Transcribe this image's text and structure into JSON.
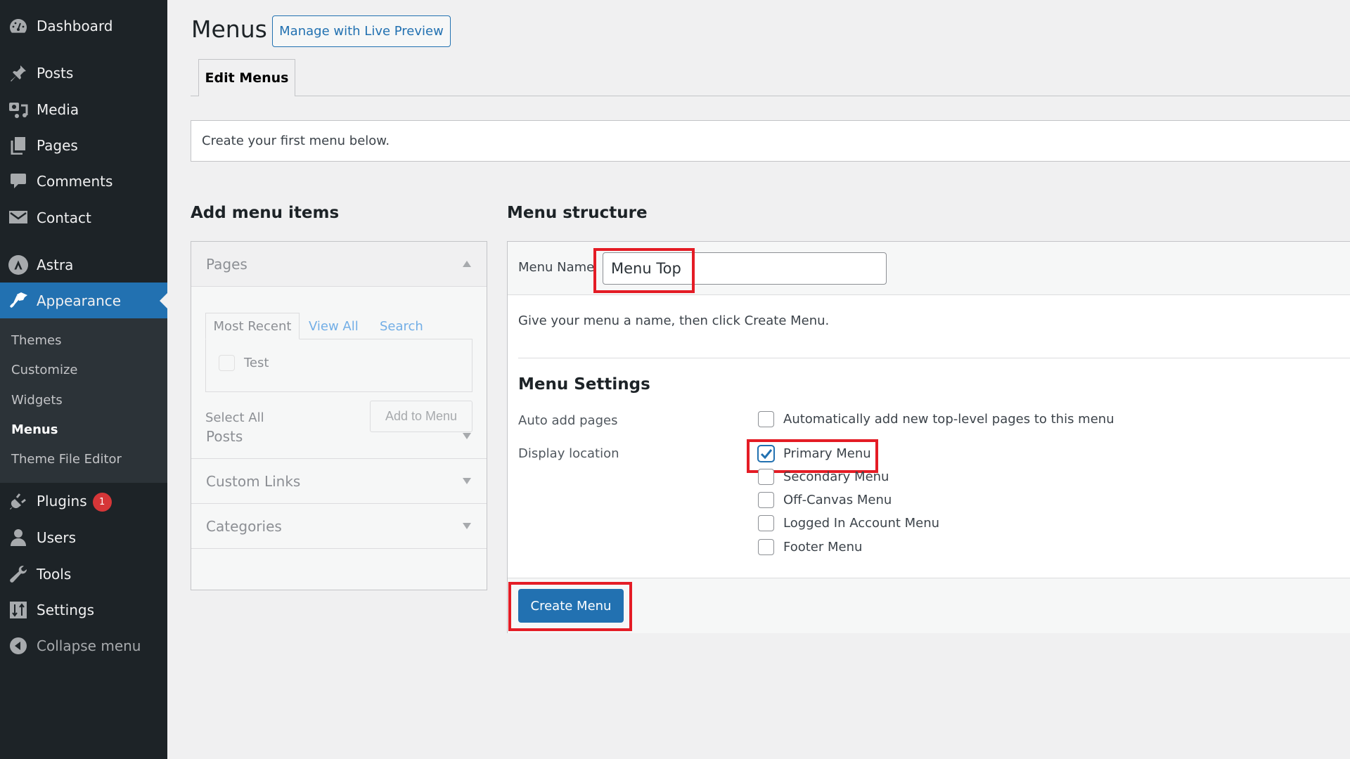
{
  "sidebar": {
    "items": [
      {
        "label": "Dashboard",
        "icon": "dashboard-icon"
      },
      {
        "label": "Posts",
        "icon": "pushpin-icon"
      },
      {
        "label": "Media",
        "icon": "media-icon"
      },
      {
        "label": "Pages",
        "icon": "pages-icon"
      },
      {
        "label": "Comments",
        "icon": "comment-icon"
      },
      {
        "label": "Contact",
        "icon": "envelope-icon"
      },
      {
        "label": "Astra",
        "icon": "astra-logo-icon"
      },
      {
        "label": "Appearance",
        "icon": "paintbrush-icon",
        "active": true
      },
      {
        "label": "Plugins",
        "icon": "plug-icon",
        "badge": "1"
      },
      {
        "label": "Users",
        "icon": "user-icon"
      },
      {
        "label": "Tools",
        "icon": "wrench-icon"
      },
      {
        "label": "Settings",
        "icon": "sliders-icon"
      },
      {
        "label": "Collapse menu",
        "icon": "collapse-arrow-icon"
      }
    ],
    "submenu": [
      {
        "label": "Themes"
      },
      {
        "label": "Customize"
      },
      {
        "label": "Widgets"
      },
      {
        "label": "Menus",
        "current": true
      },
      {
        "label": "Theme File Editor"
      }
    ]
  },
  "header": {
    "title": "Menus",
    "live_preview_button": "Manage with Live Preview",
    "tabs": [
      {
        "label": "Edit Menus",
        "active": true
      }
    ]
  },
  "notice": "Create your first menu below.",
  "add_items": {
    "heading": "Add menu items",
    "sections": [
      {
        "label": "Pages",
        "expanded": true
      },
      {
        "label": "Posts",
        "expanded": false
      },
      {
        "label": "Custom Links",
        "expanded": false
      },
      {
        "label": "Categories",
        "expanded": false
      }
    ],
    "pages_tabs": [
      "Most Recent",
      "View All",
      "Search"
    ],
    "pages_list": [
      {
        "label": "Test",
        "checked": false
      }
    ],
    "select_all": "Select All",
    "add_button": "Add to Menu"
  },
  "structure": {
    "heading": "Menu structure",
    "menu_name_label": "Menu Name",
    "menu_name_value": "Menu Top",
    "description": "Give your menu a name, then click Create Menu.",
    "settings_title": "Menu Settings",
    "auto_add_label": "Auto add pages",
    "auto_add_option": {
      "label": "Automatically add new top-level pages to this menu",
      "checked": false
    },
    "display_location_label": "Display location",
    "locations": [
      {
        "label": "Primary Menu",
        "checked": true
      },
      {
        "label": "Secondary Menu",
        "checked": false
      },
      {
        "label": "Off-Canvas Menu",
        "checked": false
      },
      {
        "label": "Logged In Account Menu",
        "checked": false
      },
      {
        "label": "Footer Menu",
        "checked": false
      }
    ],
    "create_button": "Create Menu"
  },
  "colors": {
    "sidebar_bg": "#1d2327",
    "submenu_bg": "#2c3338",
    "accent": "#2271b1",
    "badge": "#d63638",
    "highlight_box": "#e41c25"
  }
}
